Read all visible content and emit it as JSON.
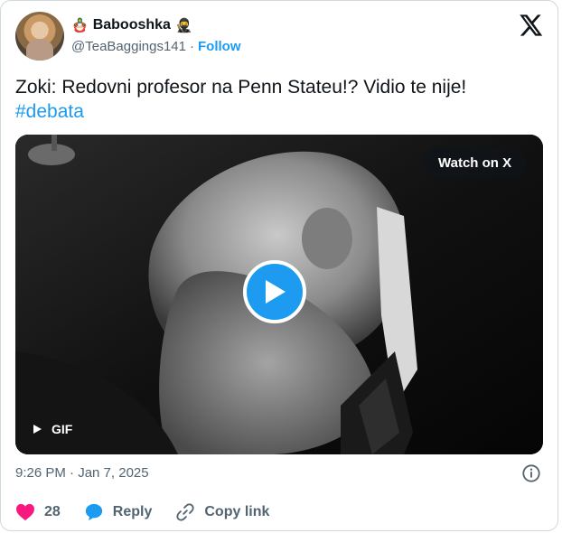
{
  "author": {
    "display_name": "Babooshka",
    "name_prefix_emoji": "🪆",
    "name_suffix_emoji": "🥷",
    "handle": "@TeaBaggings141",
    "separator": "·",
    "follow_label": "Follow"
  },
  "tweet": {
    "text": "Zoki: Redovni profesor na Penn Stateu!? Vidio te nije!",
    "hashtag": "#debata"
  },
  "media": {
    "watch_label": "Watch on X",
    "type_label": "GIF"
  },
  "meta": {
    "timestamp": "9:26 PM · Jan 7, 2025"
  },
  "actions": {
    "like_count": "28",
    "reply_label": "Reply",
    "copy_link_label": "Copy link"
  },
  "colors": {
    "accent": "#1d9bf0",
    "like": "#f91880",
    "text": "#0f1419",
    "muted": "#536471"
  },
  "icons": [
    "x-logo-icon",
    "play-icon",
    "gif-play-icon",
    "info-icon",
    "heart-icon",
    "reply-bubble-icon",
    "link-icon"
  ]
}
